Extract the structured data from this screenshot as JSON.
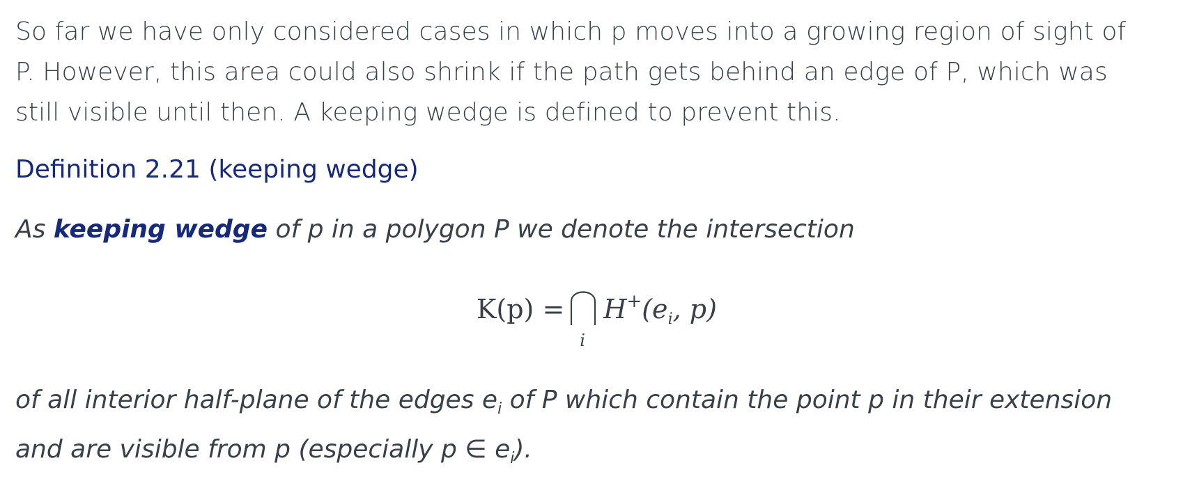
{
  "intro": {
    "line1": "So far we have only considered cases in which p moves into a growing region of sight of",
    "line2": "P. However, this area could also shrink if the path gets behind an edge of P, which was",
    "line3": "still visible until then. A keeping wedge is defined to prevent this."
  },
  "definition": {
    "heading": "Definition 2.21 (keeping wedge)",
    "body_prefix": "As ",
    "term": "keeping wedge",
    "body_suffix": " of p in a polygon P we denote the intersection"
  },
  "formula": {
    "lhs": "K(p) =",
    "cap_index": "i",
    "rhs_H": "H",
    "rhs_sup": "+",
    "rhs_open": "(e",
    "rhs_sub": "i",
    "rhs_close": ", p)"
  },
  "closing": {
    "line1_a": "of all interior half-plane of the edges e",
    "line1_sub": "i",
    "line1_b": " of P which contain the point p in their extension",
    "line2_a": "and are visible from p (especially p ∈ e",
    "line2_sub": "i",
    "line2_b": ")."
  },
  "colors": {
    "text": "#3a4047",
    "accent": "#17297a"
  }
}
